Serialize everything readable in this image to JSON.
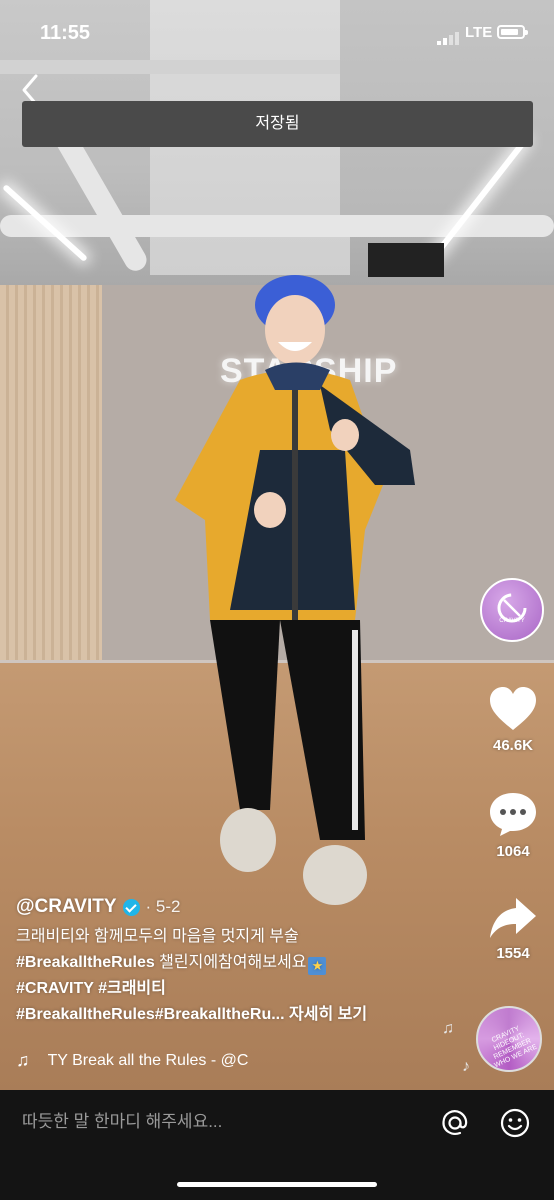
{
  "status_bar": {
    "time": "11:55",
    "network": "LTE",
    "battery_level": 0.85
  },
  "header": {
    "back_icon": "chevron-left-icon",
    "toast": "저장됨"
  },
  "video_background": {
    "sign": "STARSHIP"
  },
  "right_rail": {
    "avatar_text": "CRAVITY",
    "likes": "46.6K",
    "comments": "1064",
    "shares": "1554"
  },
  "caption": {
    "author": "@CRAVITY",
    "date": "· 5-2",
    "line1": "크래비티와 함께모두의 마음을 멋지게 부술",
    "line2_tag": "#BreakalltheRules",
    "line2_text": " 챌린지에참여해보세요",
    "line3": "#CRAVITY #크래비티",
    "line4_tags": "#BreakalltheRules#BreakalltheRu...",
    "line4_more": " 자세히 보기"
  },
  "music": {
    "note_icon": "music-note-icon",
    "text": "TY     Break all the Rules - @C"
  },
  "disc": {
    "text": "CRAVITY HIDEOUT: REMEMBER WHO WE ARE"
  },
  "comment_bar": {
    "placeholder": "따듯한 말 한마디 해주세요..."
  },
  "colors": {
    "verified": "#20b5e8",
    "avatar": "#b46fcb",
    "comment_bar": "#141414"
  }
}
